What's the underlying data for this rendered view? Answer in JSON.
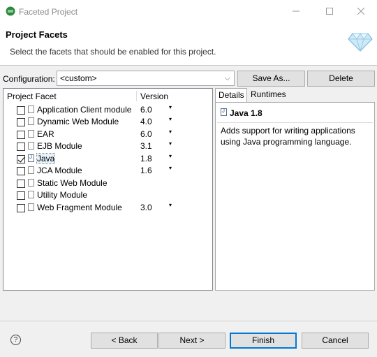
{
  "window": {
    "title": "Faceted Project",
    "app_icon": "eclipse-icon",
    "minimize_icon": "minimize-icon",
    "maximize_icon": "maximize-icon",
    "close_icon": "close-icon"
  },
  "header": {
    "title": "Project Facets",
    "description": "Select the facets that should be enabled for this project.",
    "icon": "diamond-icon"
  },
  "configuration": {
    "label": "Configuration:",
    "value": "<custom>",
    "save_as_label": "Save As...",
    "delete_label": "Delete"
  },
  "facets": {
    "column_facet": "Project Facet",
    "column_version": "Version",
    "rows": [
      {
        "name": "Application Client module",
        "version": "6.0",
        "checked": false,
        "has_dropdown": true
      },
      {
        "name": "Dynamic Web Module",
        "version": "4.0",
        "checked": false,
        "has_dropdown": true
      },
      {
        "name": "EAR",
        "version": "6.0",
        "checked": false,
        "has_dropdown": true
      },
      {
        "name": "EJB Module",
        "version": "3.1",
        "checked": false,
        "has_dropdown": true
      },
      {
        "name": "Java",
        "version": "1.8",
        "checked": true,
        "has_dropdown": true
      },
      {
        "name": "JCA Module",
        "version": "1.6",
        "checked": false,
        "has_dropdown": true
      },
      {
        "name": "Static Web Module",
        "version": "",
        "checked": false,
        "has_dropdown": false
      },
      {
        "name": "Utility Module",
        "version": "",
        "checked": false,
        "has_dropdown": false
      },
      {
        "name": "Web Fragment Module",
        "version": "3.0",
        "checked": false,
        "has_dropdown": true
      }
    ]
  },
  "details": {
    "tabs": [
      "Details",
      "Runtimes"
    ],
    "title": "Java 1.8",
    "description": "Adds support for writing applications using Java programming language."
  },
  "footer": {
    "help_label": "?",
    "back_label": "< Back",
    "next_label": "Next >",
    "finish_label": "Finish",
    "cancel_label": "Cancel"
  },
  "colors": {
    "accent": "#0078d7",
    "selection": "#e5f1fb"
  }
}
